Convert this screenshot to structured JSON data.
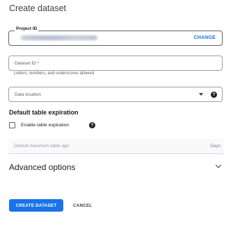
{
  "dialog": {
    "title": "Create dataset"
  },
  "project_id": {
    "label": "Project ID",
    "value_obscured": true,
    "change_label": "CHANGE"
  },
  "dataset_id": {
    "placeholder": "Dataset ID",
    "required_marker": "*",
    "hint": "Letters, numbers, and underscores allowed"
  },
  "data_location": {
    "placeholder": "Data location",
    "help_glyph": "?"
  },
  "default_table_expiration": {
    "heading": "Default table expiration",
    "checkbox_label": "Enable table expiration",
    "checkbox_checked": false,
    "help_glyph": "?",
    "max_age_placeholder": "Default maximum table age",
    "unit_suffix": "Days"
  },
  "advanced_options": {
    "label": "Advanced options",
    "expanded": false
  },
  "actions": {
    "create_label": "CREATE DATASET",
    "cancel_label": "CANCEL"
  },
  "colors": {
    "accent": "#1a73e8",
    "required": "#d93025",
    "text_primary": "#202124",
    "text_secondary": "#5f6368"
  }
}
